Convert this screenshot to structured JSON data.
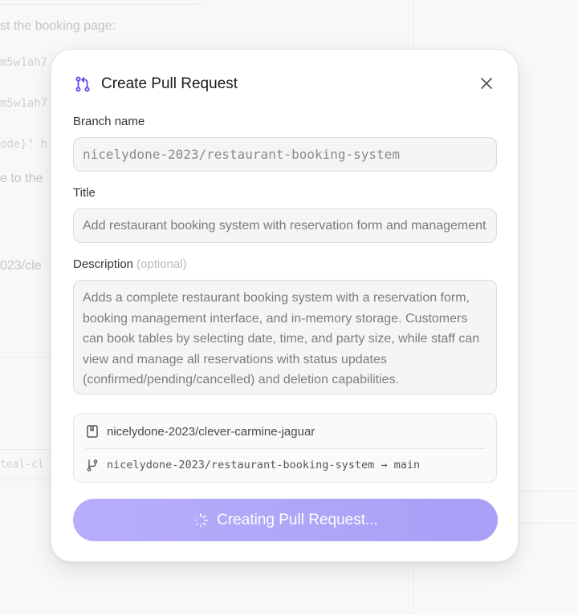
{
  "background": {
    "line_top": "st the booking page:",
    "code1": "m5w1ah7",
    "code2": "m5w1ah7",
    "code3": "ode}\" h",
    "line_mid": "e to the",
    "line_low": "023/cle",
    "code4": "teal-cl"
  },
  "modal": {
    "title": "Create Pull Request",
    "branch_label": "Branch name",
    "branch_value": "nicelydone-2023/restaurant-booking-system",
    "title_label": "Title",
    "title_value": "Add restaurant booking system with reservation form and management",
    "description_label": "Description",
    "description_optional": "(optional)",
    "description_value": "Adds a complete restaurant booking system with a reservation form, booking management interface, and in-memory storage. Customers can book tables by selecting date, time, and party size, while staff can view and manage all reservations with status updates (confirmed/pending/cancelled) and deletion capabilities.",
    "repo": "nicelydone-2023/clever-carmine-jaguar",
    "branch_flow": "nicelydone-2023/restaurant-booking-system → main",
    "submit_label": "Creating Pull Request..."
  },
  "colors": {
    "accent": "#6b5cf5",
    "button": "#aca3f8"
  },
  "icons": {
    "header": "git-pull-request-icon",
    "close": "close-icon",
    "repo": "repository-icon",
    "branch": "git-branch-icon",
    "spinner": "loading-spinner-icon"
  }
}
